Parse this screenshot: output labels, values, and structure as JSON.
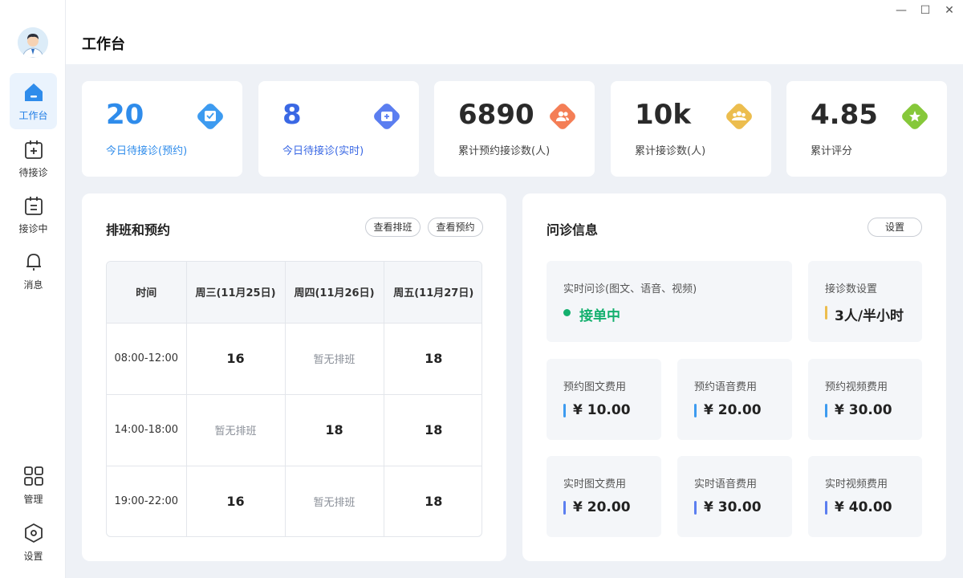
{
  "header": {
    "title": "工作台"
  },
  "window_controls": {
    "minimize": "—",
    "maximize": "☐",
    "close": "✕"
  },
  "sidebar": {
    "items": [
      {
        "label": "工作台",
        "icon": "home-icon",
        "active": true
      },
      {
        "label": "待接诊",
        "icon": "calendar-add-icon"
      },
      {
        "label": "接诊中",
        "icon": "calendar-list-icon"
      },
      {
        "label": "消息",
        "icon": "bell-icon"
      },
      {
        "label": "管理",
        "icon": "grid-icon"
      },
      {
        "label": "设置",
        "icon": "hexagon-settings-icon"
      }
    ]
  },
  "stats": [
    {
      "value": "20",
      "label": "今日待接诊(预约)",
      "icon": "calendar-check-icon",
      "color": "#3d9bf0"
    },
    {
      "value": "8",
      "label": "今日待接诊(实时)",
      "icon": "medical-plus-icon",
      "color": "#5b7ef0"
    },
    {
      "value": "6890",
      "label": "累计预约接诊数(人)",
      "icon": "users-icon",
      "color": "#f47e56"
    },
    {
      "value": "10k",
      "label": "累计接诊数(人)",
      "icon": "group-icon",
      "color": "#ecbd4e"
    },
    {
      "value": "4.85",
      "label": "累计评分",
      "icon": "star-icon",
      "color": "#86c83a"
    }
  ],
  "schedule": {
    "title": "排班和预约",
    "view_schedule_label": "查看排班",
    "view_appointments_label": "查看预约",
    "columns": [
      "时间",
      "周三(11月25日)",
      "周四(11月26日)",
      "周五(11月27日)"
    ],
    "rows": [
      [
        "08:00-12:00",
        "16",
        "暂无排班",
        "18"
      ],
      [
        "14:00-18:00",
        "暂无排班",
        "18",
        "18"
      ],
      [
        "19:00-22:00",
        "16",
        "暂无排班",
        "18"
      ]
    ]
  },
  "consult": {
    "title": "问诊信息",
    "settings_label": "设置",
    "realtime": {
      "label": "实时问诊(图文、语音、视频)",
      "status": "接单中"
    },
    "capacity": {
      "label": "接诊数设置",
      "value": "3人/半小时"
    },
    "fees": [
      {
        "label": "预约图文费用",
        "value": "¥ 10.00"
      },
      {
        "label": "预约语音费用",
        "value": "¥ 20.00"
      },
      {
        "label": "预约视频费用",
        "value": "¥ 30.00"
      },
      {
        "label": "实时图文费用",
        "value": "¥ 20.00"
      },
      {
        "label": "实时语音费用",
        "value": "¥ 30.00"
      },
      {
        "label": "实时视频费用",
        "value": "¥ 40.00"
      }
    ]
  },
  "colors": {
    "accent": "#1f7de6",
    "fee_bar_booked": "#3d9bf0",
    "fee_bar_realtime": "#5b7ef0",
    "capacity_bar": "#ecbd4e",
    "online": "#14b06e"
  }
}
